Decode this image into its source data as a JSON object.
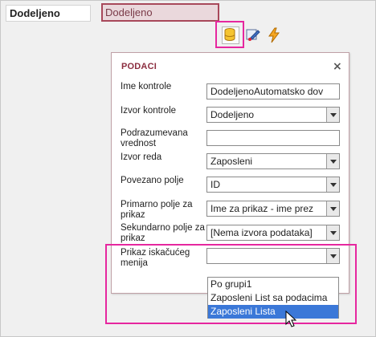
{
  "canvas": {
    "label_text": "Dodeljeno",
    "field_text": "Dodeljeno"
  },
  "toolbar": {
    "data_icon": "database-icon",
    "format_icon": "format-brush-icon",
    "event_icon": "lightning-icon"
  },
  "panel": {
    "title": "PODACI",
    "close_label": "×",
    "properties": [
      {
        "label": "Ime kontrole",
        "value": "DodeljenoAutomatsko dov",
        "has_dropdown": false
      },
      {
        "label": "Izvor kontrole",
        "value": "Dodeljeno",
        "has_dropdown": true
      },
      {
        "label": "Podrazumevana vrednost",
        "value": "",
        "has_dropdown": false
      },
      {
        "label": "Izvor reda",
        "value": "Zaposleni",
        "has_dropdown": true
      },
      {
        "label": "Povezano polje",
        "value": "ID",
        "has_dropdown": true
      },
      {
        "label": "Primarno polje za prikaz",
        "value": "Ime za prikaz - ime prez",
        "has_dropdown": true
      },
      {
        "label": "Sekundarno polje za prikaz",
        "value": "[Nema izvora podataka]",
        "has_dropdown": true
      },
      {
        "label": "Prikaz iskačućeg menija",
        "value": "",
        "has_dropdown": true
      }
    ]
  },
  "popup_list": {
    "items": [
      "Po grupi1",
      "Zaposleni List sa podacima",
      "Zaposleni Lista"
    ],
    "selected_index": 2
  },
  "colors": {
    "accent": "#8b2d3f",
    "highlight": "#e6279f",
    "selection": "#3b78d8"
  }
}
